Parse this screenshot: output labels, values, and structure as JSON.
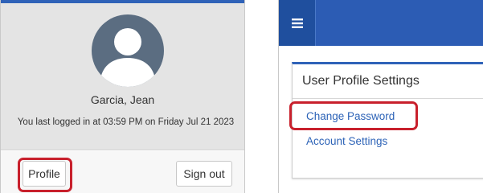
{
  "user_menu": {
    "name": "Garcia, Jean",
    "last_login": "You last logged in at 03:59 PM on Friday Jul 21 2023",
    "profile_label": "Profile",
    "signout_label": "Sign out",
    "avatar_icon": "user-silhouette-icon"
  },
  "settings": {
    "menu_icon": "hamburger-menu-icon",
    "card_title": "User Profile Settings",
    "links": [
      {
        "label": "Change Password"
      },
      {
        "label": "Account Settings"
      }
    ]
  },
  "colors": {
    "brand_blue": "#2c5cb4",
    "link_blue": "#2d63b7",
    "highlight_red": "#c8202c",
    "avatar_bg": "#5b6d81"
  }
}
